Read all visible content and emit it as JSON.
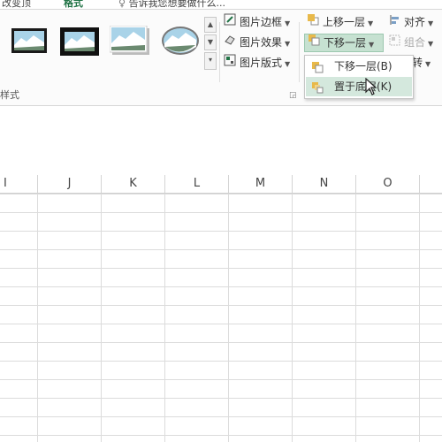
{
  "tabs": {
    "items": [
      {
        "label": "改变顶"
      },
      {
        "label": "格式"
      },
      {
        "label": "告诉我您想要做什么..."
      }
    ]
  },
  "ribbon": {
    "group_label": "样式",
    "gallery_thumbs": [
      "thumb-1",
      "thumb-2",
      "thumb-3",
      "thumb-4"
    ],
    "picture_border": "图片边框",
    "picture_effects": "图片效果",
    "picture_layout": "图片版式",
    "bring_forward": "上移一层",
    "send_backward": "下移一层",
    "align": "对齐",
    "group": "组合",
    "rotate": "转"
  },
  "dropdown": {
    "items": [
      {
        "label": "下移一层(B)"
      },
      {
        "label": "置于底层(K)"
      }
    ]
  },
  "sheet": {
    "columns": [
      "I",
      "J",
      "K",
      "L",
      "M",
      "N",
      "O"
    ]
  },
  "colors": {
    "accent": "#217346",
    "hover": "#d4e8dd",
    "selected_button": "#c6e1d1"
  }
}
